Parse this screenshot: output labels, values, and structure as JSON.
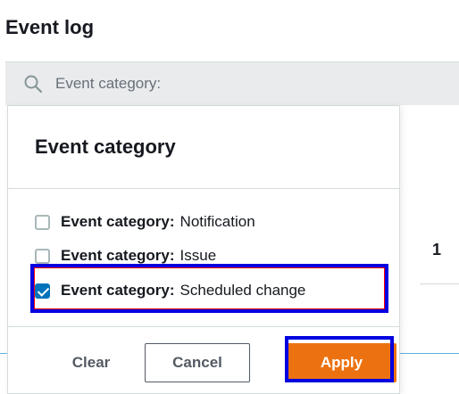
{
  "page": {
    "title": "Event log"
  },
  "filter": {
    "placeholder": "Event category:"
  },
  "background": {
    "count": "1"
  },
  "dropdown": {
    "heading": "Event category",
    "options": [
      {
        "key": "Event category:",
        "value": "Notification",
        "checked": false
      },
      {
        "key": "Event category:",
        "value": "Issue",
        "checked": false
      },
      {
        "key": "Event category:",
        "value": "Scheduled change",
        "checked": true
      }
    ],
    "buttons": {
      "clear": "Clear",
      "cancel": "Cancel",
      "apply": "Apply"
    }
  },
  "colors": {
    "accent": "#0073bb",
    "primary_button": "#ec7211",
    "highlight": "#0000e0",
    "filter_bg": "#e9ebed"
  },
  "icons": {
    "search": "search-icon",
    "check": "check-icon"
  }
}
